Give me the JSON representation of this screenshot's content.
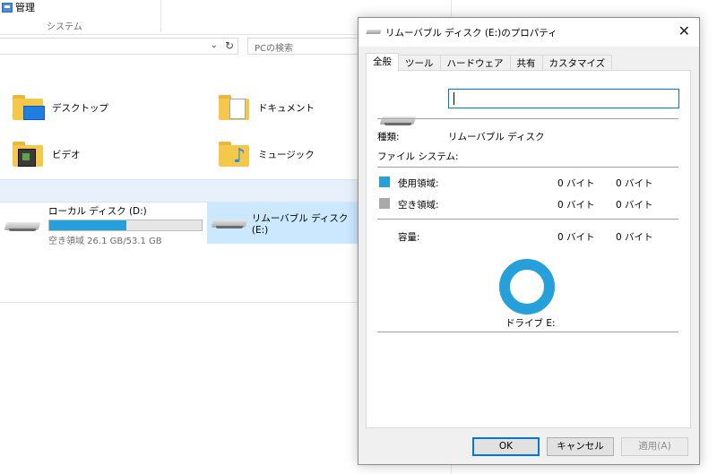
{
  "ribbon": {
    "manage_label": "管理",
    "group_label": "システム"
  },
  "address": {
    "search_placeholder": "PCの検索"
  },
  "folders": [
    {
      "name": "デスクトップ"
    },
    {
      "name": "ドキュメント"
    },
    {
      "name": "ビデオ"
    },
    {
      "name": "ミュージック"
    }
  ],
  "drives": {
    "local": {
      "name": "ローカル ディスク (D:)",
      "free_text": "空き領域 26.1 GB/53.1 GB",
      "used_fraction": 0.508
    },
    "removable": {
      "name": "リムーバブル ディスク (E:)"
    }
  },
  "dialog": {
    "title": "リムーバブル ディスク (E:)のプロパティ",
    "tabs": [
      "全般",
      "ツール",
      "ハードウェア",
      "共有",
      "カスタマイズ"
    ],
    "name_value": "",
    "type_label": "種類:",
    "type_value": "リムーバブル ディスク",
    "fs_label": "ファイル システム:",
    "fs_value": "",
    "used_label": "使用領域:",
    "used_bytes": "0 バイト",
    "used_size": "0 バイト",
    "free_label": "空き領域:",
    "free_bytes": "0 バイト",
    "free_size": "0 バイト",
    "capacity_label": "容量:",
    "capacity_bytes": "0 バイト",
    "capacity_size": "0 バイト",
    "drive_label": "ドライブ E:",
    "colors": {
      "used": "#26a0da",
      "free": "#a9a9a9"
    },
    "buttons": {
      "ok": "OK",
      "cancel": "キャンセル",
      "apply": "適用(A)"
    }
  }
}
